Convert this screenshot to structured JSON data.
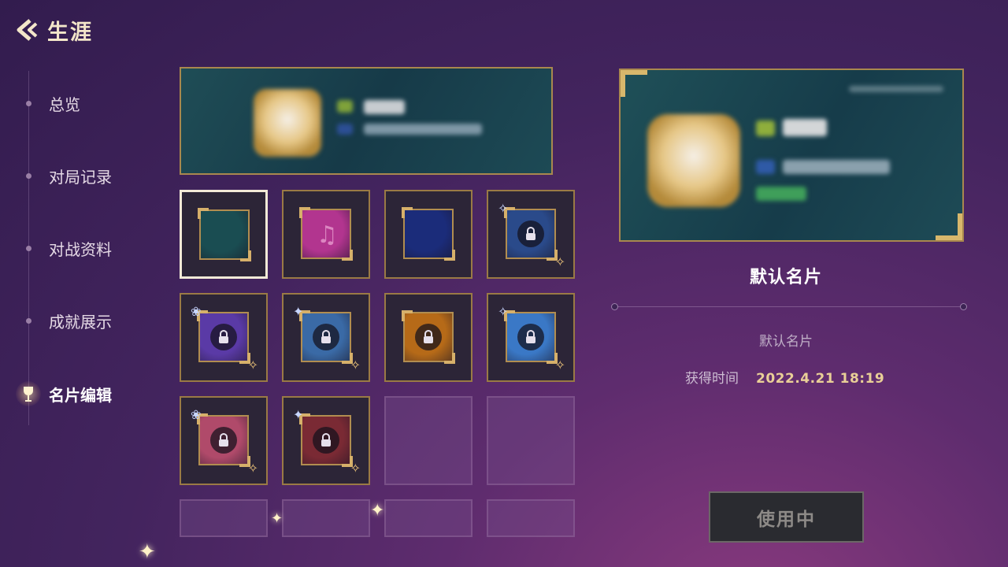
{
  "header": {
    "title": "生涯",
    "back_icon": "back-arrow-icon"
  },
  "sidebar": {
    "items": [
      {
        "label": "总览",
        "active": false
      },
      {
        "label": "对局记录",
        "active": false
      },
      {
        "label": "对战资料",
        "active": false
      },
      {
        "label": "成就展示",
        "active": false
      },
      {
        "label": "名片编辑",
        "active": true,
        "icon": "trophy-icon"
      }
    ]
  },
  "cards": [
    {
      "state": "selected",
      "locked": false,
      "color": "#1a4d52"
    },
    {
      "state": "normal",
      "locked": false,
      "color": "#b2358f",
      "icon": "music-note-icon"
    },
    {
      "state": "normal",
      "locked": false,
      "color": "#1b2c7a"
    },
    {
      "state": "normal",
      "locked": true,
      "color": "#2a4a8a"
    },
    {
      "state": "normal",
      "locked": true,
      "color": "#5a3aa6"
    },
    {
      "state": "normal",
      "locked": true,
      "color": "#3a6aa6"
    },
    {
      "state": "normal",
      "locked": true,
      "color": "#b66a18"
    },
    {
      "state": "normal",
      "locked": true,
      "color": "#3a78c6"
    },
    {
      "state": "normal",
      "locked": true,
      "color": "#b04a6a"
    },
    {
      "state": "normal",
      "locked": true,
      "color": "#7a2a34"
    },
    {
      "state": "empty"
    },
    {
      "state": "empty"
    },
    {
      "state": "empty"
    },
    {
      "state": "empty"
    },
    {
      "state": "empty"
    },
    {
      "state": "empty"
    }
  ],
  "detail": {
    "title": "默认名片",
    "description": "默认名片",
    "obtain_label": "获得时间",
    "obtain_value": "2022.4.21   18:19"
  },
  "use_button": {
    "label": "使用中"
  },
  "colors": {
    "accent_gold": "#a9884e",
    "background": "#43245e"
  }
}
